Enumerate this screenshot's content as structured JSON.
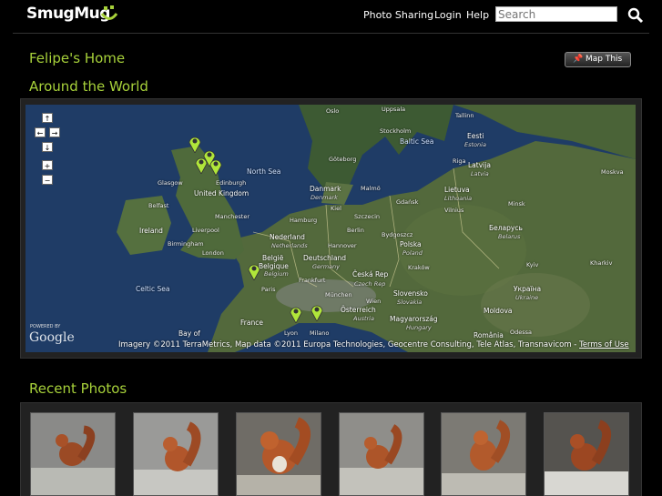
{
  "header": {
    "logo_text": "SmugMug",
    "nav": {
      "photo_sharing": "Photo Sharing",
      "login": "Login",
      "help": "Help"
    },
    "search_placeholder": "Search"
  },
  "page": {
    "title": "Felipe's Home",
    "map_this_label": "Map This",
    "map_section_title": "Around the World",
    "recent_title": "Recent Photos"
  },
  "map": {
    "attribution": "Imagery ©2011 TerraMetrics, Map data ©2011 Europa Technologies, Geocentre Consulting, Tele Atlas, Transnavicom -",
    "terms": "Terms of Use",
    "powered_by": "POWERED BY",
    "google": "Google",
    "labels": {
      "north_sea": "North Sea",
      "baltic_sea": "Baltic Sea",
      "celtic_sea": "Celtic Sea",
      "bay_of": "Bay of",
      "ireland": "Ireland",
      "united_kingdom": "United Kingdom",
      "glasgow": "Glasgow",
      "edinburgh": "Edinburgh",
      "belfast": "Belfast",
      "manchester": "Manchester",
      "liverpool": "Liverpool",
      "birmingham": "Birmingham",
      "london": "London",
      "france": "France",
      "nederland": "Nederland",
      "netherlands": "Netherlands",
      "belgie": "België",
      "belgique": "Belgique",
      "belgium": "Belgium",
      "deutschland": "Deutschland",
      "germany": "Germany",
      "danmark": "Danmark",
      "denmark": "Denmark",
      "hamburg": "Hamburg",
      "hannover": "Hannover",
      "berlin": "Berlin",
      "frankfurt": "Frankfurt",
      "munchen": "München",
      "polska": "Polska",
      "poland": "Poland",
      "ceska": "Česká Rep",
      "czech": "Czech Rep",
      "slovensko": "Slovensko",
      "slovakia": "Slovakia",
      "osterreich": "Österreich",
      "austria": "Austria",
      "magyarorszag": "Magyarország",
      "hungary": "Hungary",
      "romania": "România",
      "ukraina": "Україна",
      "ukraine": "Ukraine",
      "belarus_cyr": "Беларусь",
      "belarus": "Belarus",
      "lietuva": "Lietuva",
      "lithuania": "Lithuania",
      "latvija": "Latvija",
      "latvia": "Latvia",
      "eesti": "Eesti",
      "estonia": "Estonia",
      "moldova": "Moldova",
      "stockholm": "Stockholm",
      "goteborg": "Göteborg",
      "oslo": "Oslo",
      "uppsala": "Uppsala",
      "malmo": "Malmö",
      "gdansk": "Gdańsk",
      "szczecin": "Szczecin",
      "bydgoszcz": "Bydgoszcz",
      "krakow": "Kraków",
      "wien": "Wien",
      "milano": "Milano",
      "lyon": "Lyon",
      "kyiv": "Kyiv",
      "minsk": "Minsk",
      "moskva": "Moskva",
      "kharkiv": "Kharkiv",
      "riga": "Riga",
      "tallinn": "Tallinn",
      "vilnius": "Vilnius",
      "odessa": "Odessa",
      "kiel": "Kiel",
      "paris": "Paris"
    }
  },
  "colors": {
    "accent": "#a7d13a",
    "background": "#000000",
    "panel": "#222222"
  },
  "photos": [
    {
      "alt": "red squirrel on branch"
    },
    {
      "alt": "red squirrel"
    },
    {
      "alt": "red squirrel close-up"
    },
    {
      "alt": "red squirrel on lichen"
    },
    {
      "alt": "red squirrel sitting"
    },
    {
      "alt": "red squirrel in snow"
    }
  ]
}
